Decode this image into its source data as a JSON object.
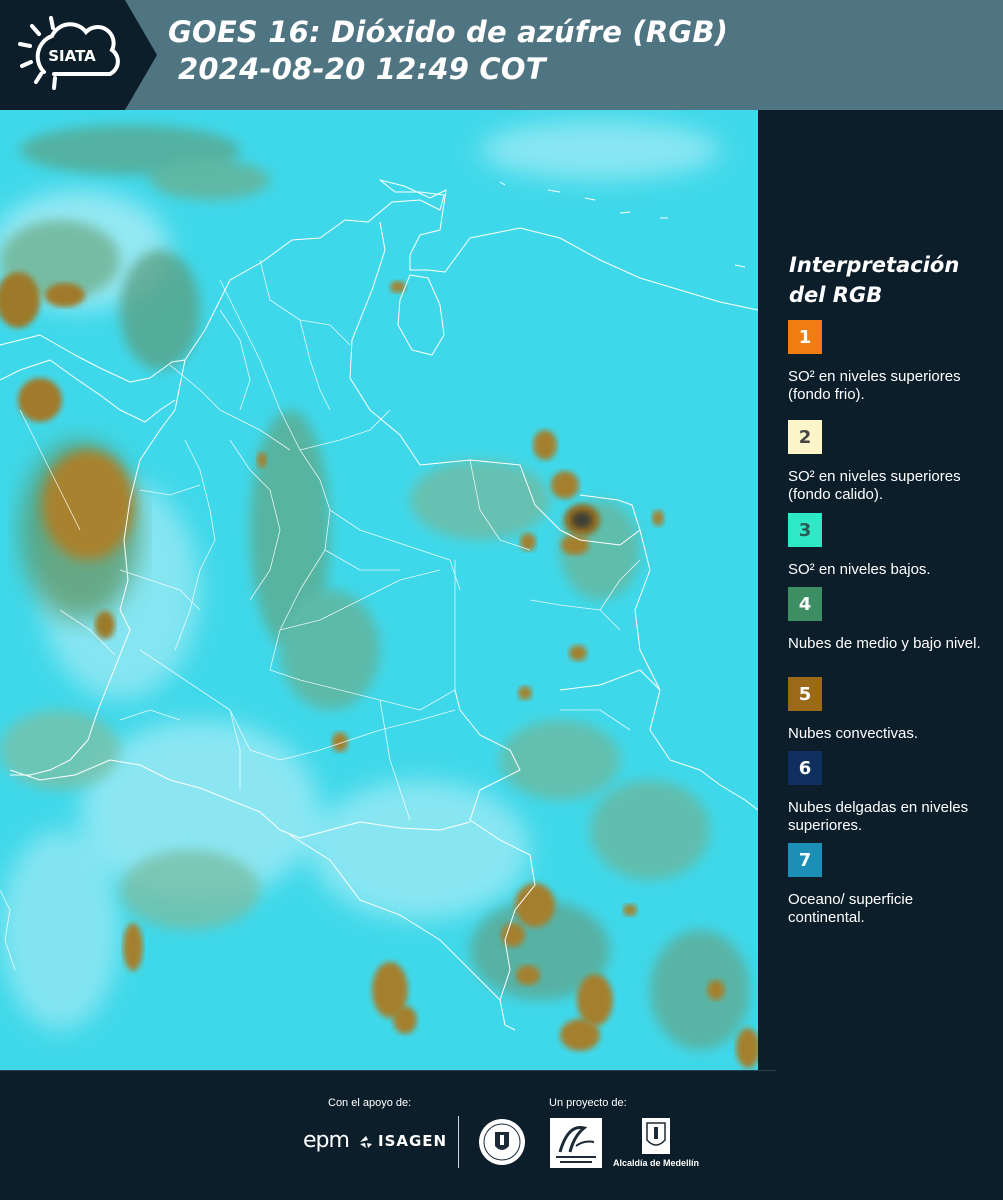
{
  "header": {
    "logo_text": "SIATA",
    "title_line1": "GOES 16: Dióxido de azúfre (RGB)",
    "title_line2": "2024-08-20 12:49 COT"
  },
  "legend": {
    "title_line1": "Interpretación",
    "title_line2": "del RGB",
    "items": [
      {
        "number": "1",
        "color": "#f07d12",
        "text": "SO² en niveles superiores (fondo frio)."
      },
      {
        "number": "2",
        "color": "#fbf5c9",
        "text": "SO² en niveles superiores (fondo calido)."
      },
      {
        "number": "3",
        "color": "#2ee8c6",
        "text": "SO² en niveles bajos."
      },
      {
        "number": "4",
        "color": "#3d8f63",
        "text": "Nubes de medio y bajo nivel."
      },
      {
        "number": "5",
        "color": "#9a6a18",
        "text": "Nubes convectivas."
      },
      {
        "number": "6",
        "color": "#0f2f5e",
        "text": "Nubes delgadas en niveles superiores."
      },
      {
        "number": "7",
        "color": "#1b8fb5",
        "text": "Oceano/ superficie continental."
      }
    ]
  },
  "footer": {
    "support_label": "Con el apoyo de:",
    "project_label": "Un proyecto de:",
    "epm_text": "epm",
    "isagen_text": "ISAGEN",
    "alcaldia_text": "Alcaldía de Medellín"
  }
}
